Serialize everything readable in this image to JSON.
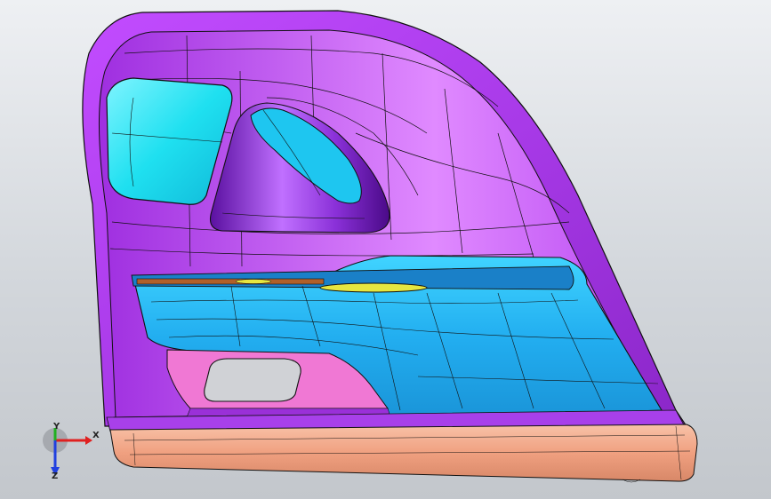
{
  "viewport": {
    "background_top": "#eef0f3",
    "background_bottom": "#c3c7cc"
  },
  "model": {
    "colors": {
      "trim_panel": "#b23ff0",
      "trim_panel_light": "#d66bff",
      "trim_panel_dark": "#7a1fb0",
      "window_glass": "#22e2f0",
      "armrest": "#28b9ef",
      "armrest_dark": "#1486c8",
      "pocket": "#f07bd2",
      "bottom_strip": "#f0a88a",
      "bottom_strip_dark": "#c97a60",
      "wire_edges": "#111111",
      "highlight": "#e8e84a"
    }
  },
  "triad": {
    "x_label": "X",
    "y_label": "Y",
    "z_label": "Z",
    "x_color": "#e02020",
    "y_color": "#20b020",
    "z_color": "#2040e0"
  }
}
